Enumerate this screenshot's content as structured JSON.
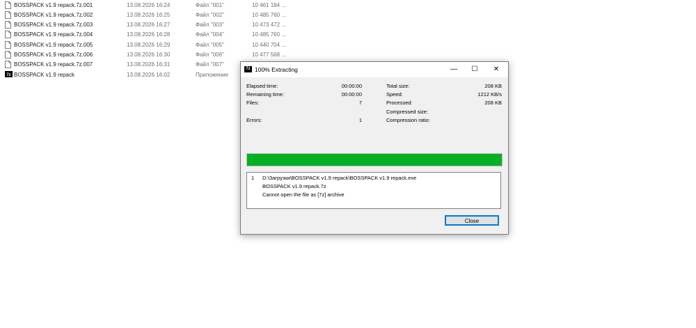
{
  "files": [
    {
      "name": "BOSSPACK v1.9 repack.7z.001",
      "date": "13.08.2026 16:24",
      "type": "Файл \"001\"",
      "size": "10 461 184 ...",
      "icon": "file-icon"
    },
    {
      "name": "BOSSPACK v1.9 repack.7z.002",
      "date": "13.08.2026 16:25",
      "type": "Файл \"002\"",
      "size": "10 485 760 ...",
      "icon": "file-icon"
    },
    {
      "name": "BOSSPACK v1.9 repack.7z.003",
      "date": "13.08.2026 16:27",
      "type": "Файл \"003\"",
      "size": "10 473 472 ...",
      "icon": "file-icon"
    },
    {
      "name": "BOSSPACK v1.9 repack.7z.004",
      "date": "13.08.2026 16:28",
      "type": "Файл \"004\"",
      "size": "10 485 760 ...",
      "icon": "file-icon"
    },
    {
      "name": "BOSSPACK v1.9 repack.7z.005",
      "date": "13.08.2026 16:29",
      "type": "Файл \"005\"",
      "size": "10 440 704 ...",
      "icon": "file-icon"
    },
    {
      "name": "BOSSPACK v1.9 repack.7z.006",
      "date": "13.08.2026 16:30",
      "type": "Файл \"006\"",
      "size": "10 477 568 ...",
      "icon": "file-icon"
    },
    {
      "name": "BOSSPACK v1.9 repack.7z.007",
      "date": "13.08.2026 16:31",
      "type": "Файл \"007\"",
      "size": "",
      "icon": "file-icon"
    },
    {
      "name": "BOSSPACK v1.9 repack",
      "date": "13.08.2026 16:02",
      "type": "Приложение",
      "size": "",
      "icon": "sevenzip-app-icon"
    }
  ],
  "dialog": {
    "app_icon_text": "7z",
    "title": "100% Extracting",
    "controls": {
      "minimize": "—",
      "maximize": "☐",
      "close": "✕"
    },
    "stats_left": [
      {
        "label": "Elapsed time:",
        "value": "00:00:00"
      },
      {
        "label": "Remaining time:",
        "value": "00:00:00"
      },
      {
        "label": "Files:",
        "value": "7"
      },
      {
        "label": "Errors:",
        "value": "1"
      }
    ],
    "stats_right": [
      {
        "label": "Total size:",
        "value": "208 KB"
      },
      {
        "label": "Speed:",
        "value": "1212 KB/s"
      },
      {
        "label": "Processed:",
        "value": "208 KB"
      },
      {
        "label": "Compressed size:",
        "value": ""
      },
      {
        "label": "Compression ratio:",
        "value": ""
      }
    ],
    "progress_percent": 100,
    "progress_color": "#06b025",
    "log": {
      "number": "1",
      "lines": [
        "D:\\Загрузки\\BOSSPACK v1.9 repack\\BOSSPACK v1.9 repack.exe",
        "BOSSPACK v1.9 repack.7z",
        "Cannot open the file as [7z] archive"
      ]
    },
    "close_button": "Close"
  }
}
